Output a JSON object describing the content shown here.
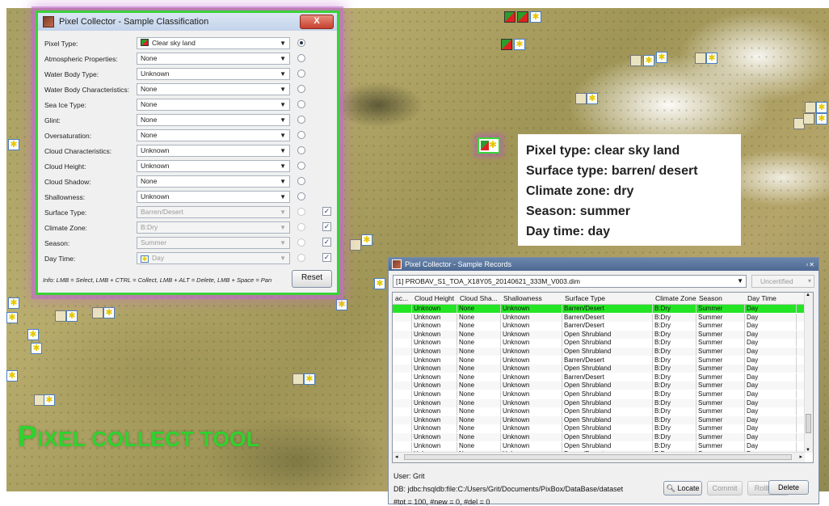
{
  "classification_window": {
    "title": "Pixel Collector - Sample Classification",
    "close_glyph": "X",
    "rows": [
      {
        "label": "Pixel Type:",
        "value": "Clear sky land",
        "swatch": "flag-icon",
        "radio": "on"
      },
      {
        "label": "Atmospheric Properties:",
        "value": "None",
        "radio": "off"
      },
      {
        "label": "Water Body Type:",
        "value": "Unknown",
        "radio": "off"
      },
      {
        "label": "Water Body Characteristics:",
        "value": "None",
        "radio": "off"
      },
      {
        "label": "Sea Ice Type:",
        "value": "None",
        "radio": "off"
      },
      {
        "label": "Glint:",
        "value": "None",
        "radio": "off"
      },
      {
        "label": "Oversaturation:",
        "value": "None",
        "radio": "off"
      },
      {
        "label": "Cloud Characteristics:",
        "value": "Unknown",
        "radio": "off"
      },
      {
        "label": "Cloud Height:",
        "value": "Unknown",
        "radio": "off"
      },
      {
        "label": "Cloud Shadow:",
        "value": "None",
        "radio": "off"
      },
      {
        "label": "Shallowness:",
        "value": "Unknown",
        "radio": "off"
      },
      {
        "label": "Surface Type:",
        "value": "Barren/Desert",
        "disabled": true,
        "checked": true
      },
      {
        "label": "Climate Zone:",
        "value": "B:Dry",
        "disabled": true,
        "checked": true
      },
      {
        "label": "Season:",
        "value": "Summer",
        "disabled": true,
        "checked": true
      },
      {
        "label": "Day Time:",
        "value": "Day",
        "swatch": "sun-icon",
        "disabled": true,
        "checked": true
      }
    ],
    "info": "Info: LMB = Select, LMB + CTRL = Collect, LMB + ALT = Delete, LMB + Space = Pan",
    "reset_label": "Reset"
  },
  "info_box": [
    "Pixel type: clear sky land",
    "Surface type: barren/ desert",
    "Climate zone: dry",
    "Season: summer",
    "Day time: day"
  ],
  "title": {
    "first": "P",
    "rest1": "IXEL COLLECT TOOL"
  },
  "records_window": {
    "title": "Pixel Collector - Sample Records",
    "window_buttons": "▫✕",
    "product": "[1] PROBAV_S1_TOA_X18Y05_20140621_333M_V003.dim",
    "certification": "Uncertified",
    "columns": [
      "ac...",
      "Cloud Height",
      "Cloud Sha...",
      "Shallowness",
      "Surface Type",
      "Climate Zone",
      "Season",
      "Day Time"
    ],
    "rows": [
      [
        "",
        "Unknown",
        "None",
        "Unknown",
        "Barren/Desert",
        "B:Dry",
        "Summer",
        "Day"
      ],
      [
        "",
        "Unknown",
        "None",
        "Unknown",
        "Barren/Desert",
        "B:Dry",
        "Summer",
        "Day"
      ],
      [
        "",
        "Unknown",
        "None",
        "Unknown",
        "Barren/Desert",
        "B:Dry",
        "Summer",
        "Day"
      ],
      [
        "",
        "Unknown",
        "None",
        "Unknown",
        "Open Shrubland",
        "B:Dry",
        "Summer",
        "Day"
      ],
      [
        "",
        "Unknown",
        "None",
        "Unknown",
        "Open Shrubland",
        "B:Dry",
        "Summer",
        "Day"
      ],
      [
        "",
        "Unknown",
        "None",
        "Unknown",
        "Open Shrubland",
        "B:Dry",
        "Summer",
        "Day"
      ],
      [
        "",
        "Unknown",
        "None",
        "Unknown",
        "Barren/Desert",
        "B:Dry",
        "Summer",
        "Day"
      ],
      [
        "",
        "Unknown",
        "None",
        "Unknown",
        "Open Shrubland",
        "B:Dry",
        "Summer",
        "Day"
      ],
      [
        "",
        "Unknown",
        "None",
        "Unknown",
        "Barren/Desert",
        "B:Dry",
        "Summer",
        "Day"
      ],
      [
        "",
        "Unknown",
        "None",
        "Unknown",
        "Open Shrubland",
        "B:Dry",
        "Summer",
        "Day"
      ],
      [
        "",
        "Unknown",
        "None",
        "Unknown",
        "Open Shrubland",
        "B:Dry",
        "Summer",
        "Day"
      ],
      [
        "",
        "Unknown",
        "None",
        "Unknown",
        "Open Shrubland",
        "B:Dry",
        "Summer",
        "Day"
      ],
      [
        "",
        "Unknown",
        "None",
        "Unknown",
        "Open Shrubland",
        "B:Dry",
        "Summer",
        "Day"
      ],
      [
        "",
        "Unknown",
        "None",
        "Unknown",
        "Open Shrubland",
        "B:Dry",
        "Summer",
        "Day"
      ],
      [
        "",
        "Unknown",
        "None",
        "Unknown",
        "Open Shrubland",
        "B:Dry",
        "Summer",
        "Day"
      ],
      [
        "",
        "Unknown",
        "None",
        "Unknown",
        "Open Shrubland",
        "B:Dry",
        "Summer",
        "Day"
      ],
      [
        "",
        "Unknown",
        "None",
        "Unknown",
        "Open Shrubland",
        "B:Dry",
        "Summer",
        "Day"
      ],
      [
        "",
        "Unknown",
        "None",
        "Unknown",
        "Barren/Desert",
        "B:Dry",
        "Summer",
        "Day"
      ]
    ],
    "user": "User: Grit",
    "db": "DB: jdbc:hsqldb:file:C:/Users/Grit/Documents/PixBox/DataBase/dataset",
    "totals": "#tot = 100, #new = 0, #del = 0",
    "buttons": {
      "locate": "Locate",
      "commit": "Commit",
      "rollback": "Rollback",
      "delete": "Delete"
    }
  },
  "colors": {
    "highlight": "#3ad13a",
    "selected_row": "#24e524",
    "glow": "#be6ec8"
  }
}
